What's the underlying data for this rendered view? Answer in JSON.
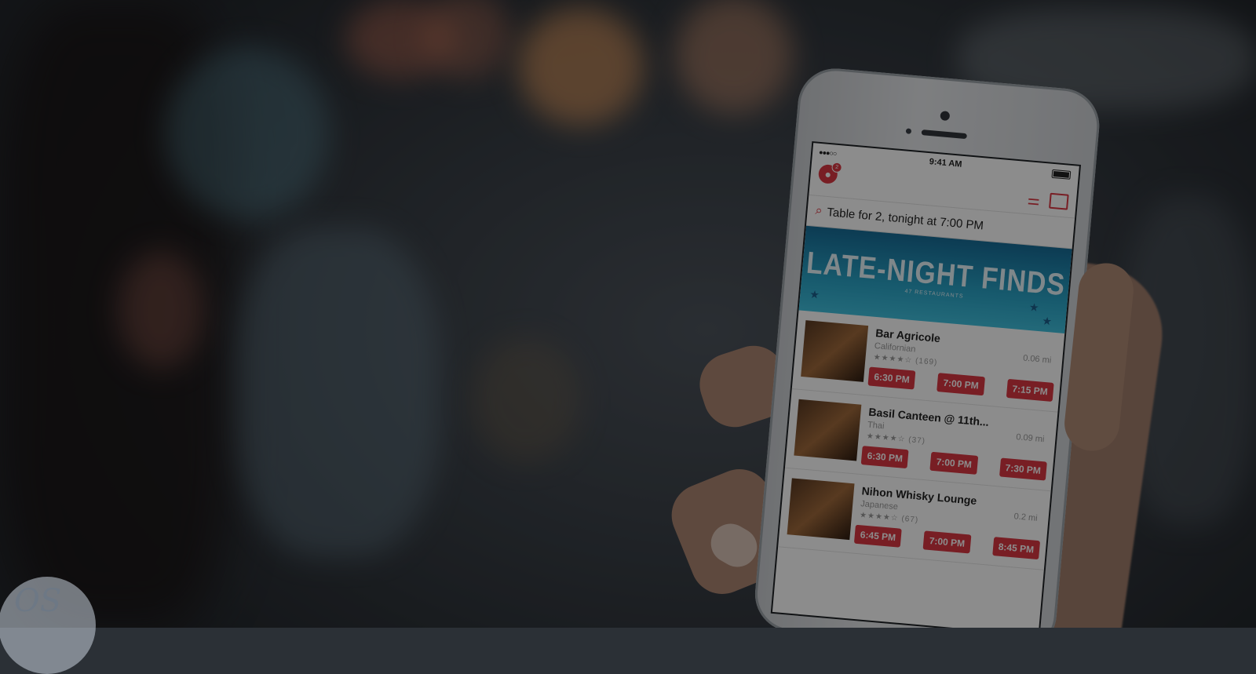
{
  "status_bar": {
    "time": "9:41 AM",
    "signal": "●●●○○"
  },
  "nav": {
    "profile_badge": "2",
    "profile_glyph": "●",
    "filter_glyph": "⚌"
  },
  "search": {
    "glyph": "⌕",
    "text": "Table for 2, tonight at 7:00 PM"
  },
  "banner": {
    "title": "LATE-NIGHT FINDS",
    "subtitle": "47 RESTAURANTS"
  },
  "restaurants": [
    {
      "name": "Bar Agricole",
      "cuisine": "Californian",
      "rating": "★★★★☆",
      "reviews": "(169)",
      "distance": "0.06 mi",
      "times": [
        "6:30 PM",
        "7:00 PM",
        "7:15 PM"
      ]
    },
    {
      "name": "Basil Canteen @ 11th...",
      "cuisine": "Thai",
      "rating": "★★★★☆",
      "reviews": "(37)",
      "distance": "0.09 mi",
      "times": [
        "6:30 PM",
        "7:00 PM",
        "7:30 PM"
      ]
    },
    {
      "name": "Nihon Whisky Lounge",
      "cuisine": "Japanese",
      "rating": "★★★★☆",
      "reviews": "(67)",
      "distance": "0.2 mi",
      "times": [
        "6:45 PM",
        "7:00 PM",
        "8:45 PM"
      ]
    }
  ],
  "logo": {
    "text": "OS"
  },
  "colors": {
    "accent": "#da3743",
    "banner": "#2aa3c6"
  }
}
